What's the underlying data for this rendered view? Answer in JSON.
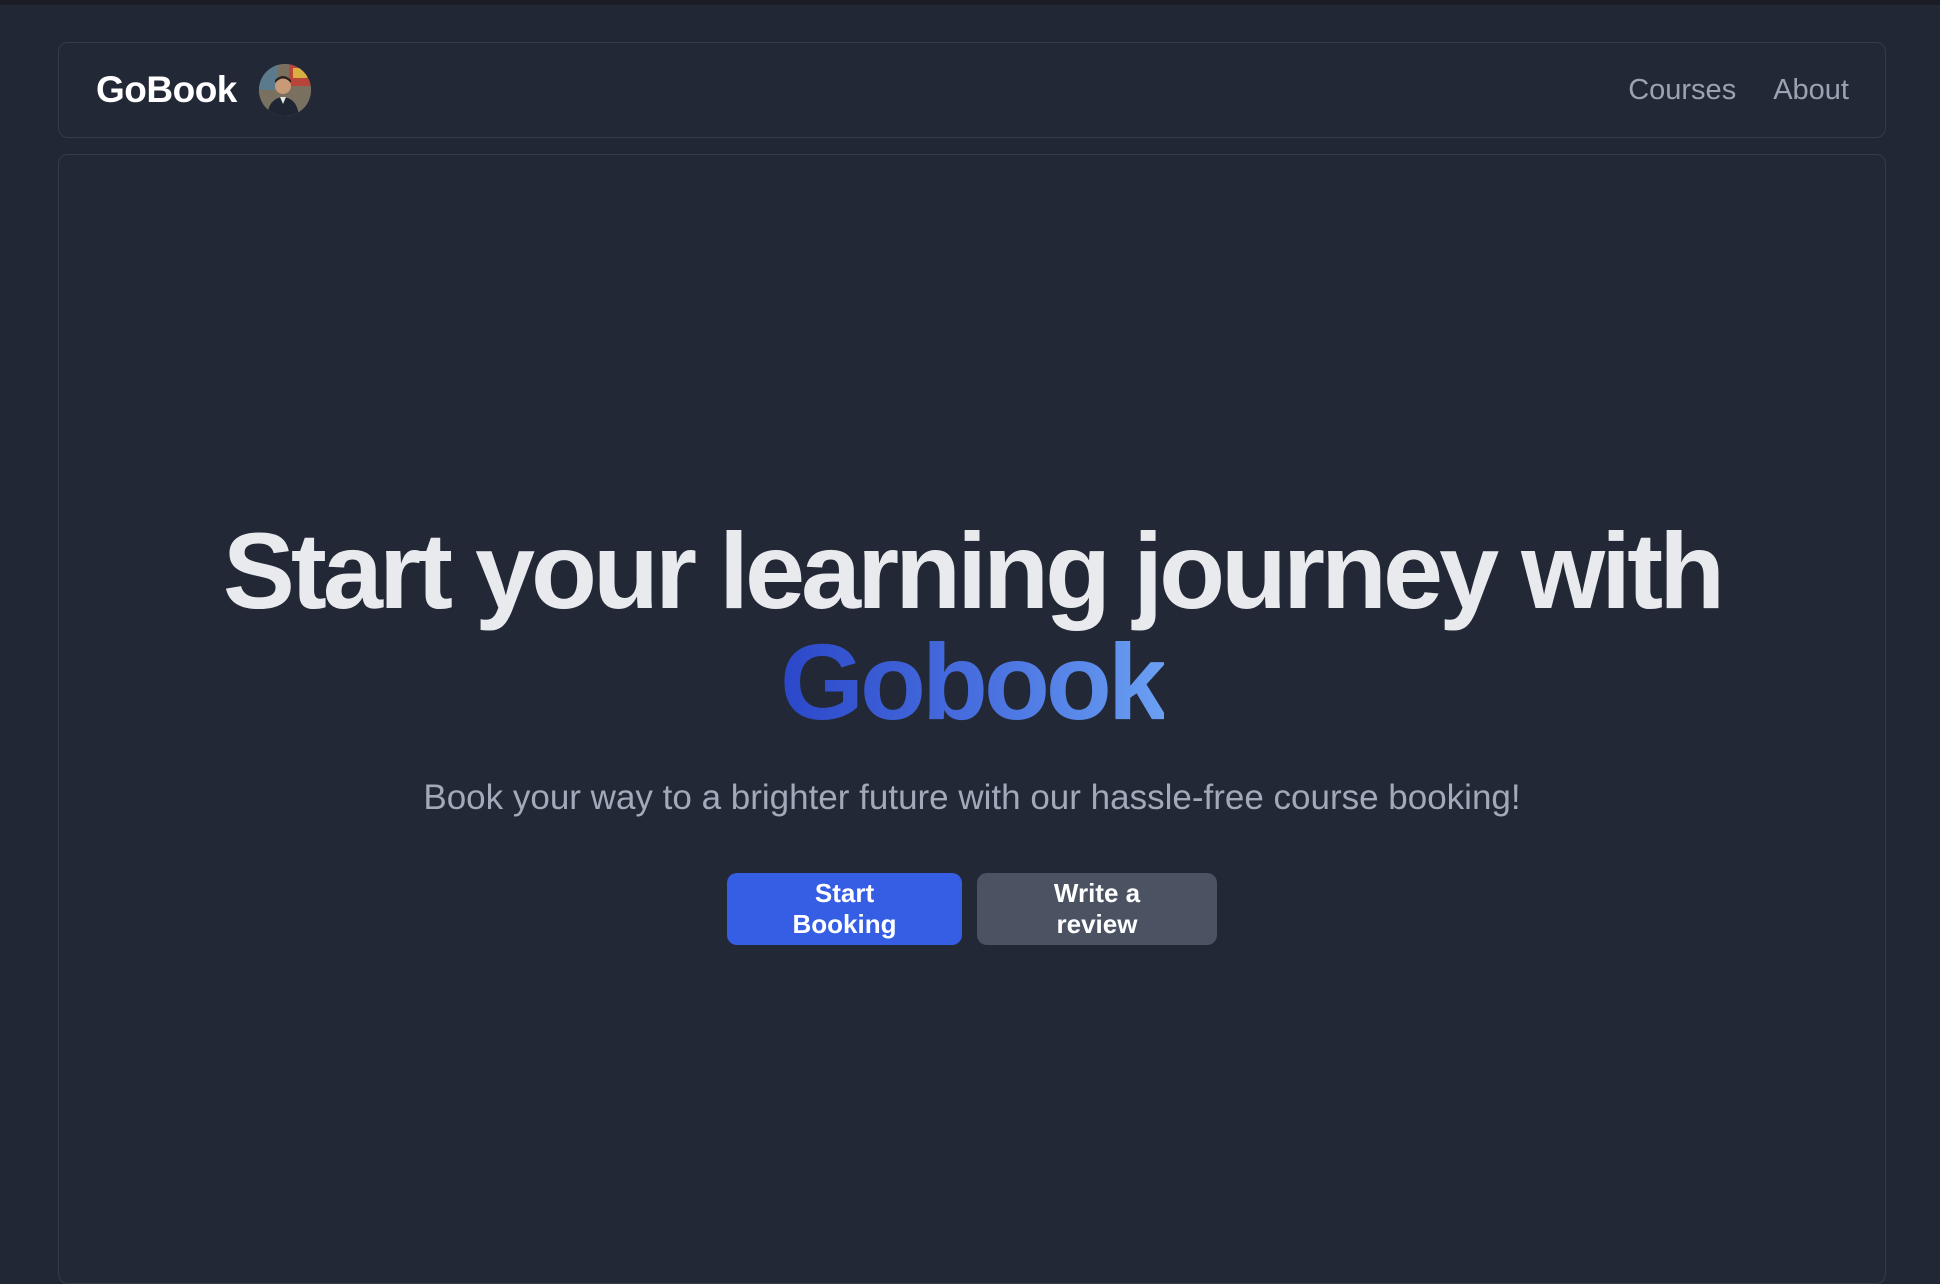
{
  "navbar": {
    "brand": "GoBook",
    "avatar_alt": "Profile photo",
    "links": [
      {
        "label": "Courses"
      },
      {
        "label": "About"
      }
    ]
  },
  "hero": {
    "headline_prefix": "Start your learning journey with",
    "headline_highlight": "Gobook",
    "subtitle": "Book your way to a brighter future with our hassle-free course booking!",
    "primary_button": "Start Booking",
    "secondary_button": "Write a review"
  },
  "colors": {
    "background": "#212735",
    "accent": "#365ee5",
    "gradient_start": "#2b47c9",
    "gradient_end": "#6aa0f3",
    "secondary_button": "#4b5262"
  }
}
